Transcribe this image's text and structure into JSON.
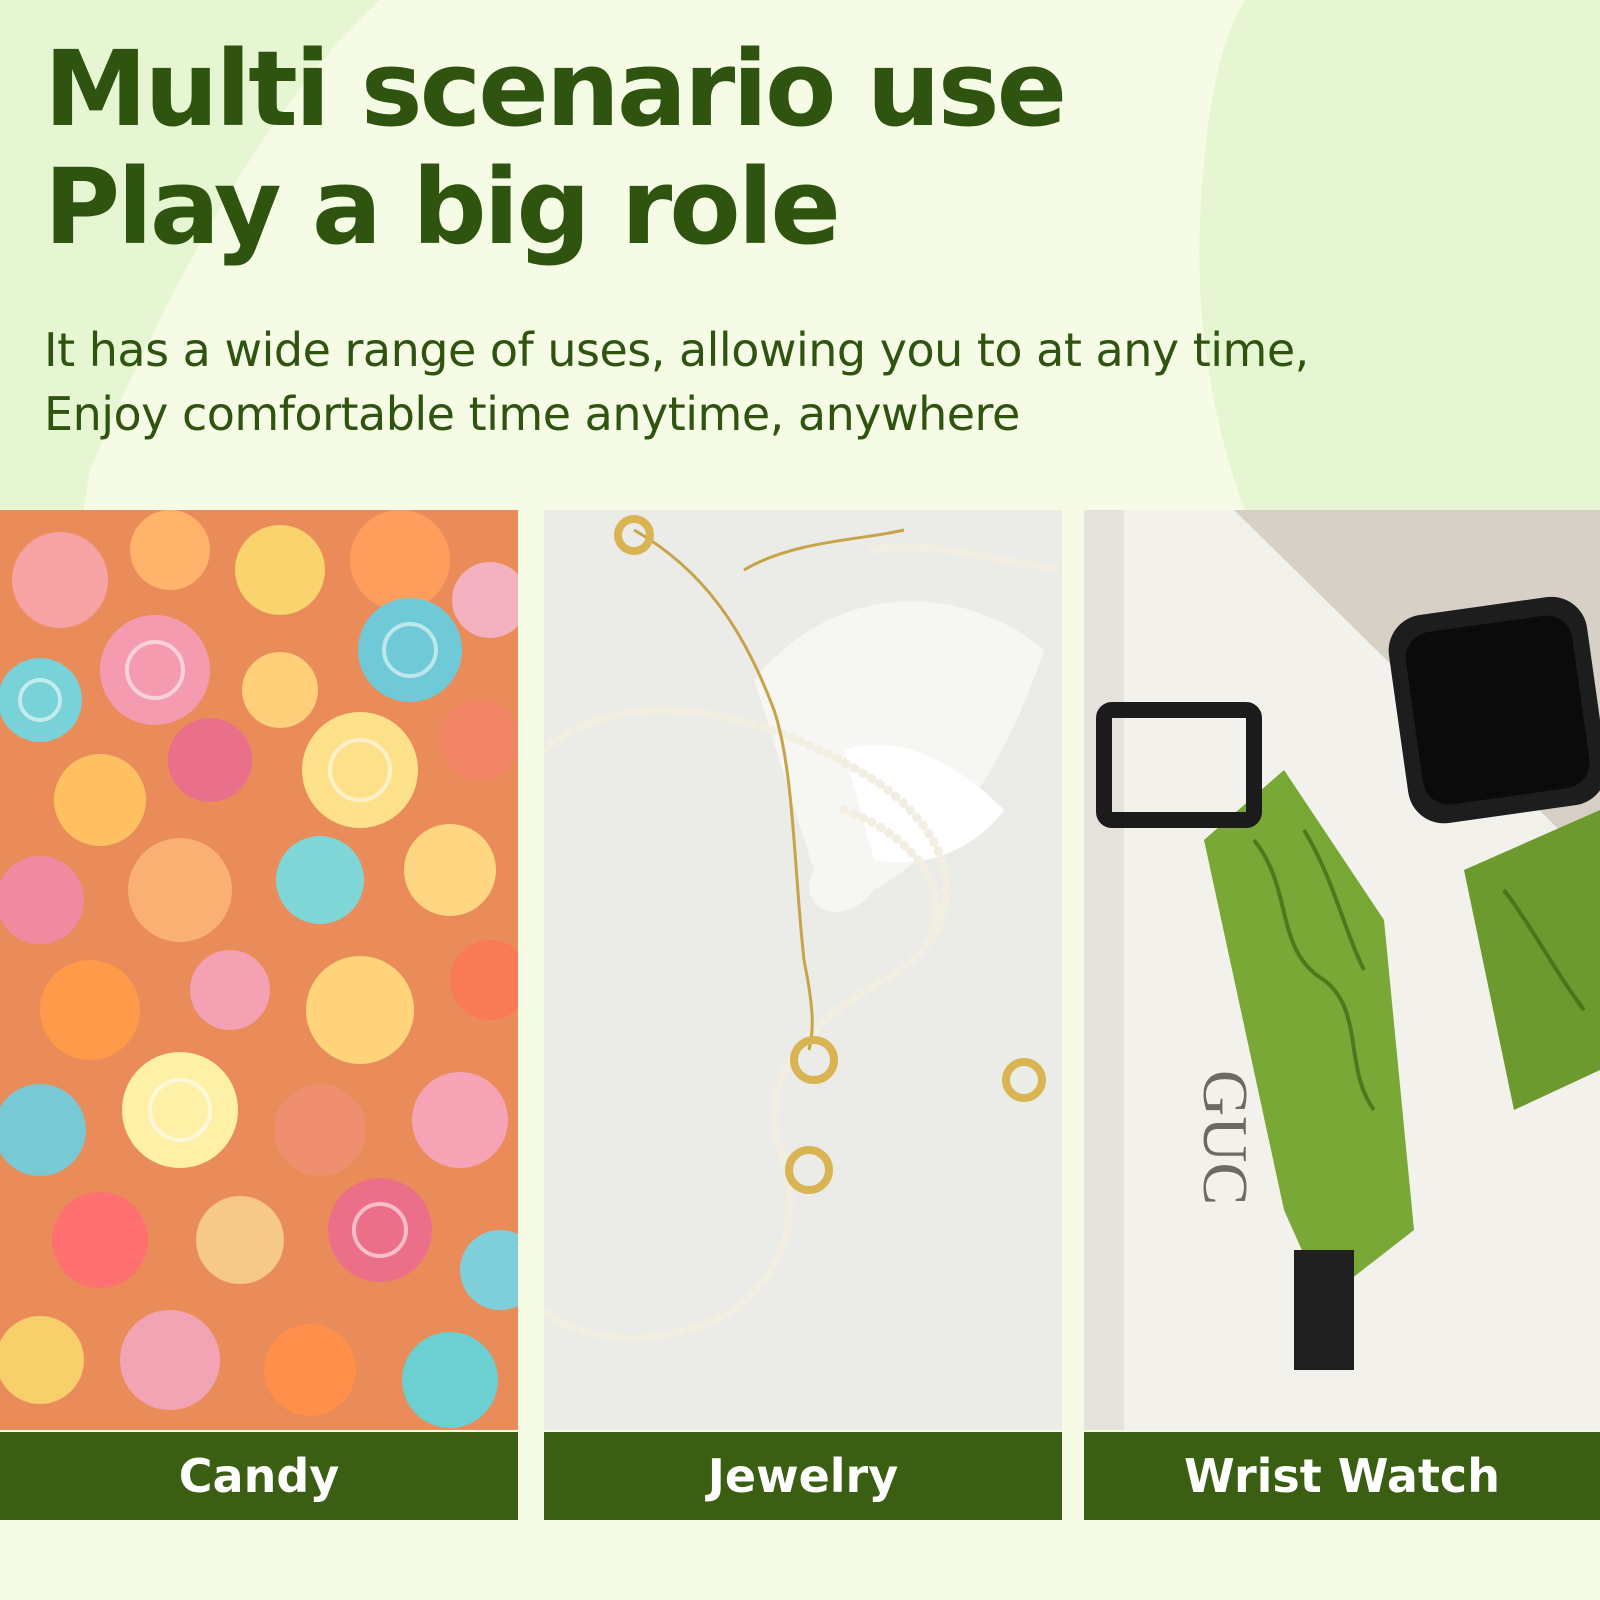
{
  "headline": {
    "line1": "Multi scenario use",
    "line2": "Play a big role"
  },
  "subtitle": {
    "line1": "It has a wide range of uses, allowing you to at any time,",
    "line2": "Enjoy comfortable time anytime, anywhere"
  },
  "scenarios": [
    {
      "label": "Candy"
    },
    {
      "label": "Jewelry"
    },
    {
      "label": "Wrist Watch"
    }
  ],
  "colors": {
    "brand_green": "#2f5410",
    "label_bar": "#3a5e12",
    "background": "#f6fbe6",
    "accent_blob": "#e5f5cf"
  }
}
